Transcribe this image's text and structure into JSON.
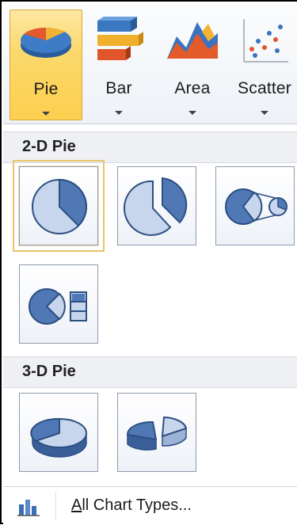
{
  "ribbon": {
    "buttons": [
      {
        "label": "Pie",
        "icon": "pie-chart-icon",
        "active": true
      },
      {
        "label": "Bar",
        "icon": "bar-chart-icon",
        "active": false
      },
      {
        "label": "Area",
        "icon": "area-chart-icon",
        "active": false
      },
      {
        "label": "Scatter",
        "icon": "scatter-chart-icon",
        "active": false
      }
    ]
  },
  "gallery": {
    "section_2d": "2-D Pie",
    "section_3d": "3-D Pie",
    "items_2d": [
      {
        "icon": "pie-icon",
        "selected": true
      },
      {
        "icon": "exploded-pie-icon",
        "selected": false
      },
      {
        "icon": "pie-of-pie-icon",
        "selected": false
      },
      {
        "icon": "bar-of-pie-icon",
        "selected": false
      }
    ],
    "items_3d": [
      {
        "icon": "3d-pie-icon",
        "selected": false
      },
      {
        "icon": "exploded-3d-pie-icon",
        "selected": false
      }
    ]
  },
  "footer": {
    "link_accel": "A",
    "link_rest": "ll Chart Types...",
    "icon": "all-chart-types-icon"
  },
  "colors": {
    "active_button": "#fcd04f",
    "pie_blue": "#4f78b5",
    "pie_light": "#c7d6ec"
  }
}
